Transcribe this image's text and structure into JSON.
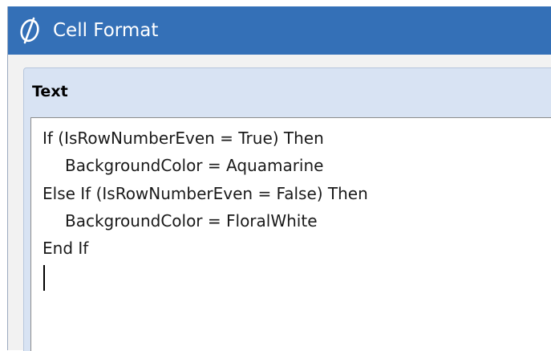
{
  "window": {
    "title": "Cell Format",
    "logo_icon": "app-logo-icon",
    "accent_color": "#3470b7"
  },
  "group": {
    "header": "Text"
  },
  "editor": {
    "lines": [
      "If (IsRowNumberEven = True) Then",
      "BackgroundColor = Aquamarine",
      "Else If (IsRowNumberEven = False) Then",
      "BackgroundColor = FloralWhite",
      "End If"
    ]
  }
}
